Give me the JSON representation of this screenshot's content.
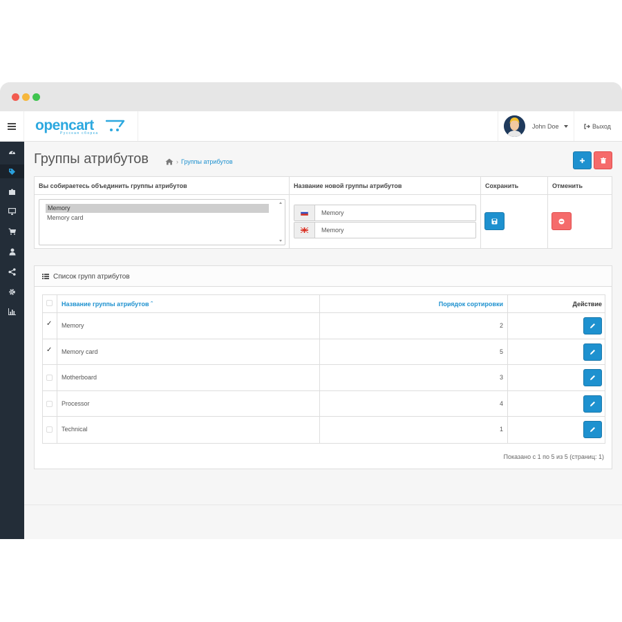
{
  "header": {
    "logo_text": "opencart",
    "logo_subtitle": "Русская сборка",
    "user_name": "John Doe",
    "logout_label": "Выход"
  },
  "sidebar": {
    "items": [
      "dashboard-icon",
      "tag-icon",
      "puzzle-icon",
      "monitor-icon",
      "cart-icon",
      "user-icon",
      "share-icon",
      "gear-icon",
      "bar-chart-icon"
    ],
    "active_index": 1
  },
  "page": {
    "title": "Группы атрибутов",
    "breadcrumb": [
      "home-icon",
      "Группы атрибутов"
    ]
  },
  "merge_form": {
    "col_merge_label": "Вы собираетесь объединить группы атрибутов",
    "col_name_label": "Название новой группы атрибутов",
    "col_save_label": "Сохранить",
    "col_cancel_label": "Отменить",
    "selected_groups": [
      "Memory",
      "Memory card"
    ],
    "selected_index": 0,
    "names": [
      {
        "lang": "ru",
        "value": "Memory"
      },
      {
        "lang": "en",
        "value": "Memory"
      }
    ]
  },
  "list": {
    "title": "Список групп атрибутов",
    "columns": {
      "name": "Название группы атрибутов",
      "sort": "Порядок сортировки",
      "action": "Действие"
    },
    "rows": [
      {
        "name": "Memory",
        "sort": "2",
        "checked": true
      },
      {
        "name": "Memory card",
        "sort": "5",
        "checked": true
      },
      {
        "name": "Motherboard",
        "sort": "3",
        "checked": false
      },
      {
        "name": "Processor",
        "sort": "4",
        "checked": false
      },
      {
        "name": "Technical",
        "sort": "1",
        "checked": false
      }
    ],
    "pagination": "Показано с 1 по 5 из 5 (страниц: 1)"
  },
  "colors": {
    "accent": "#1e91cf",
    "danger": "#f56b6b",
    "sidebar": "#232d38",
    "logo": "#2ca8df"
  }
}
